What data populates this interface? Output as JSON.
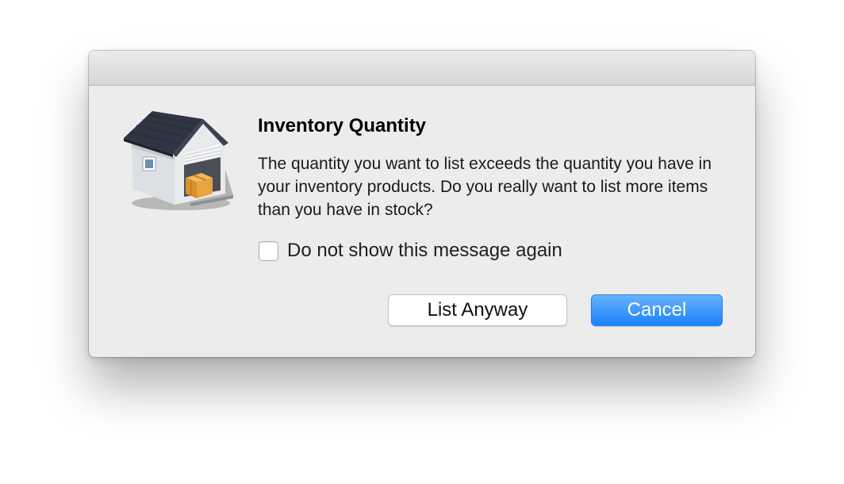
{
  "dialog": {
    "icon": "warehouse-icon",
    "title": "Inventory Quantity",
    "message": "The quantity you want to list exceeds the quantity you have in your inventory products. Do you really want to list more items than you have in stock?",
    "checkbox": {
      "label": "Do not show this message again",
      "checked": false
    },
    "buttons": {
      "list_anyway": "List Anyway",
      "cancel": "Cancel"
    }
  },
  "colors": {
    "dialog_background": "#ececec",
    "primary_button": "#1a82fb",
    "titlebar": "#d6d6d6"
  }
}
